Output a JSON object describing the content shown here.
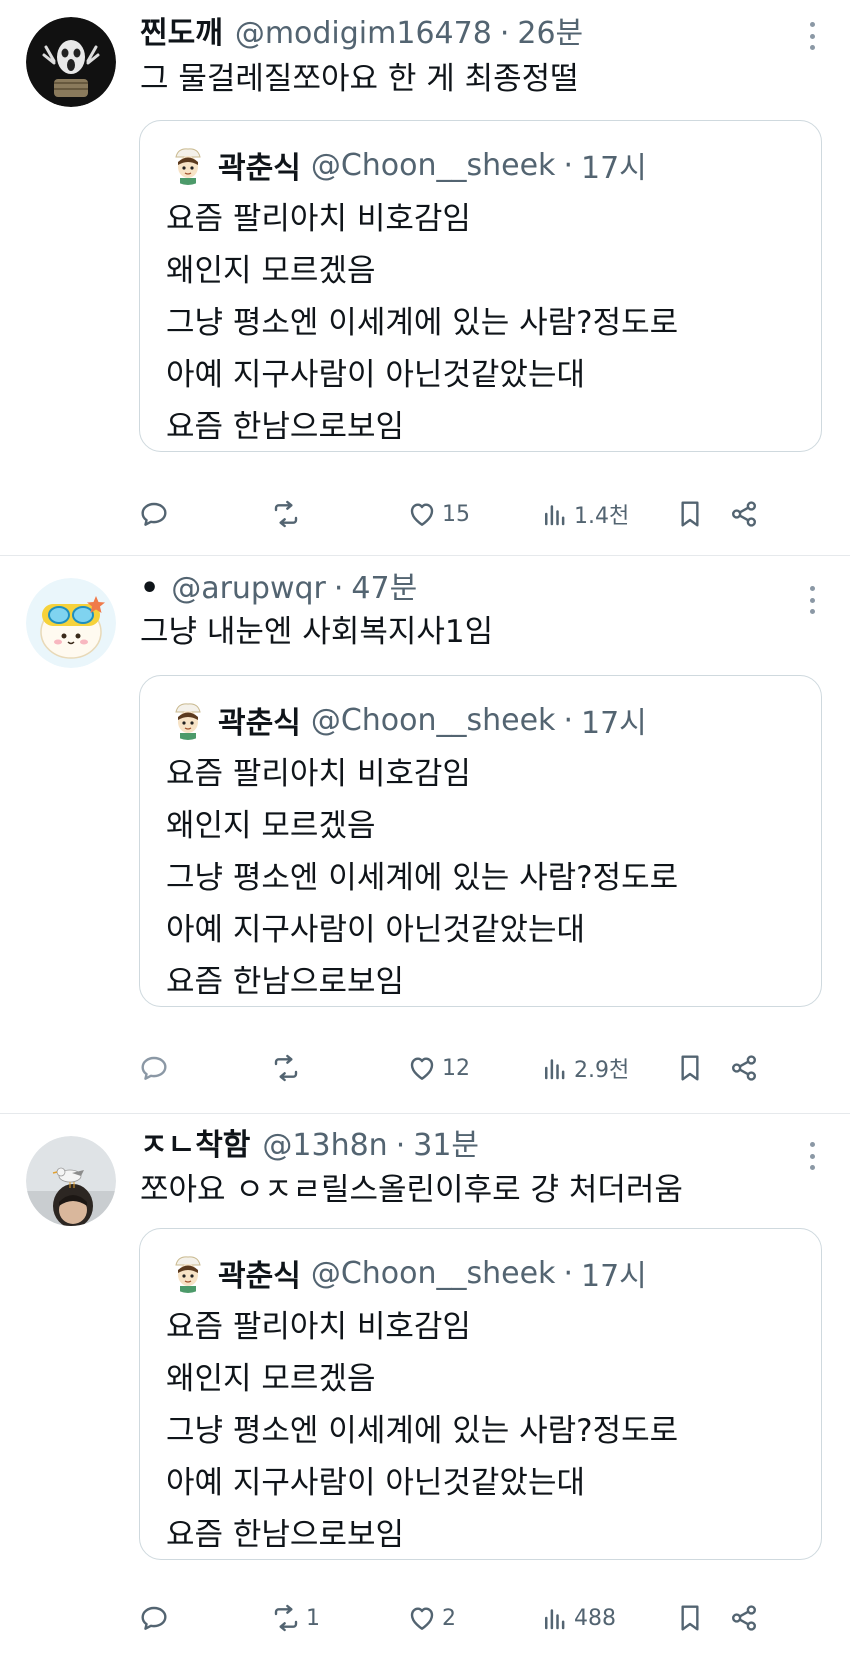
{
  "tweets": [
    {
      "name": "찐도깨",
      "handle": "@modigim16478",
      "separator": "·",
      "time": "26분",
      "text": "그 물걸레질쪼아요 한 게 최종정떨",
      "avatar_icon": "screaming-figure-avatar",
      "quote": {
        "name": "곽춘식",
        "handle": "@Choon__sheek",
        "separator": "·",
        "time": "17시",
        "lines": [
          "요즘 팔리아치 비호감임",
          "왜인지 모르겠음",
          "그냥 평소엔 이세계에 있는 사람?정도로",
          "아예 지구사람이 아닌것같았는대",
          "요즘 한남으로보임"
        ]
      },
      "stats": {
        "reply": "",
        "retweet": "",
        "like": "15",
        "views": "1.4천"
      }
    },
    {
      "name": "•",
      "handle": "@arupwqr",
      "separator": "·",
      "time": "47분",
      "text": "그냥 내눈엔 사회복지사1임",
      "avatar_icon": "goggles-character-avatar",
      "quote": {
        "name": "곽춘식",
        "handle": "@Choon__sheek",
        "separator": "·",
        "time": "17시",
        "lines": [
          "요즘 팔리아치 비호감임",
          "왜인지 모르겠음",
          "그냥 평소엔 이세계에 있는 사람?정도로",
          "아예 지구사람이 아닌것같았는대",
          "요즘 한남으로보임"
        ]
      },
      "stats": {
        "reply": "",
        "retweet": "",
        "like": "12",
        "views": "2.9천"
      }
    },
    {
      "name": "ㅈㄴ착함",
      "handle": "@13h8n",
      "separator": "·",
      "time": "31분",
      "text": "쪼아요 ㅇㅈㄹ릴스올린이후로 걍 처더러움",
      "avatar_icon": "seagull-on-head-avatar",
      "quote": {
        "name": "곽춘식",
        "handle": "@Choon__sheek",
        "separator": "·",
        "time": "17시",
        "lines": [
          "요즘 팔리아치 비호감임",
          "왜인지 모르겠음",
          "그냥 평소엔 이세계에 있는 사람?정도로",
          "아예 지구사람이 아닌것같았는대",
          "요즘 한남으로보임"
        ]
      },
      "stats": {
        "reply": "",
        "retweet": "1",
        "like": "2",
        "views": "488"
      }
    }
  ],
  "colors": {
    "text": "#0f1419",
    "secondary": "#536471",
    "border": "#cfd9de",
    "divider": "#e6e9ec"
  }
}
